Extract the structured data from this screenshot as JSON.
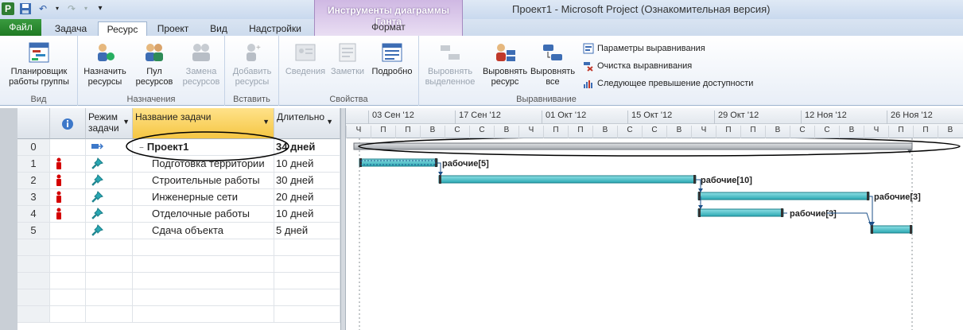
{
  "window": {
    "title": "Проект1  -  Microsoft Project (Ознакомительная версия)",
    "contextual_group": "Инструменты диаграммы Ганта",
    "contextual_tab": "Формат",
    "app_icon": "P"
  },
  "tabs": {
    "file": "Файл",
    "task": "Задача",
    "resource": "Ресурс",
    "project": "Проект",
    "view": "Вид",
    "addins": "Надстройки"
  },
  "ribbon": {
    "view_group": {
      "label": "Вид",
      "planner": "Планировщик работы группы"
    },
    "assign_group": {
      "label": "Назначения",
      "assign": "Назначить ресурсы",
      "pool": "Пул ресурсов",
      "replace": "Замена ресурсов"
    },
    "insert_group": {
      "label": "Вставить",
      "add": "Добавить ресурсы"
    },
    "props_group": {
      "label": "Свойства",
      "info": "Сведения",
      "notes": "Заметки",
      "details": "Подробно"
    },
    "level_group": {
      "label": "Выравнивание",
      "level_selection": "Выровнять выделенное",
      "level_resource": "Выровнять ресурс",
      "level_all": "Выровнять все",
      "options": "Параметры выравнивания",
      "clear": "Очистка выравнивания",
      "next_overalloc": "Следующее превышение доступности"
    }
  },
  "table": {
    "headers": {
      "info": "i",
      "mode": "Режим задачи",
      "name": "Название задачи",
      "duration": "Длительно"
    },
    "rows": [
      {
        "id": "0",
        "name": "Проект1",
        "duration": "34 дней",
        "summary": true,
        "overalloc": false
      },
      {
        "id": "1",
        "name": "Подготовка территории",
        "duration": "10 дней",
        "summary": false,
        "overalloc": true
      },
      {
        "id": "2",
        "name": "Строительные работы",
        "duration": "30 дней",
        "summary": false,
        "overalloc": true
      },
      {
        "id": "3",
        "name": "Инженерные сети",
        "duration": "20 дней",
        "summary": false,
        "overalloc": true
      },
      {
        "id": "4",
        "name": "Отделочные работы",
        "duration": "10 дней",
        "summary": false,
        "overalloc": true
      },
      {
        "id": "5",
        "name": "Сдача объекта",
        "duration": "5 дней",
        "summary": false,
        "overalloc": false
      }
    ]
  },
  "timeline": {
    "weeks": [
      "03 Сен '12",
      "17 Сен '12",
      "01 Окт '12",
      "15 Окт '12",
      "29 Окт '12",
      "12 Ноя '12",
      "26 Ноя '12"
    ],
    "days": [
      "Ч",
      "П",
      "П",
      "В",
      "С",
      "С",
      "В",
      "Ч",
      "П",
      "П",
      "В",
      "С",
      "С",
      "В",
      "Ч",
      "П",
      "П",
      "В",
      "С",
      "С",
      "В",
      "Ч",
      "П",
      "П",
      "В"
    ]
  },
  "gantt_labels": {
    "task1": "рабочие[5]",
    "task2": "рабочие[10]",
    "task3": "рабочие[3]",
    "task4": "рабочие[3]"
  },
  "colors": {
    "bar": "#2aa8b3",
    "overalloc": "#d40000",
    "selected_header": "#f5c643",
    "file_tab": "#2f8a34"
  }
}
